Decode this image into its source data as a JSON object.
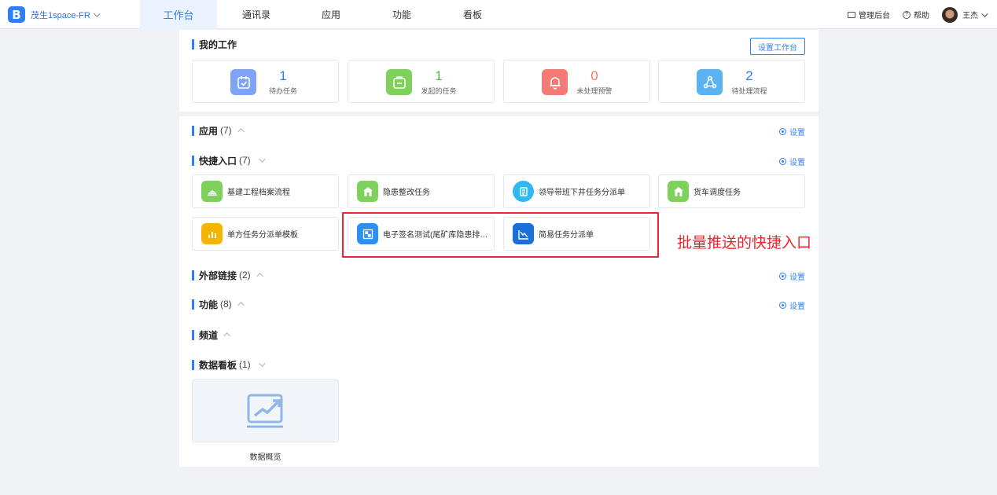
{
  "header": {
    "brand_logo": "B",
    "brand_name": "茂生1space-FR",
    "tabs": [
      "工作台",
      "通讯录",
      "应用",
      "功能",
      "看板"
    ],
    "right": {
      "admin": "管理后台",
      "help": "帮助",
      "user": "王杰"
    }
  },
  "my_work": {
    "title": "我的工作",
    "set_button": "设置工作台",
    "stats": [
      {
        "value": "1",
        "label": "待办任务",
        "color": "#7fa3f5",
        "icon": "calendar-check-icon"
      },
      {
        "value": "1",
        "label": "发起的任务",
        "color": "#7ed25b",
        "icon": "briefcase-icon"
      },
      {
        "value": "0",
        "label": "未处理预警",
        "color": "#f47a76",
        "icon": "bell-icon"
      },
      {
        "value": "2",
        "label": "待处理流程",
        "color": "#5ab2f0",
        "icon": "flow-icon"
      }
    ],
    "value_colors": [
      "#2f7ff3",
      "#5cb74a",
      "#f07a6a",
      "#2f7ff3"
    ]
  },
  "sections": {
    "apps": {
      "title": "应用",
      "count": "(7)",
      "setting": "设置"
    },
    "quick": {
      "title": "快捷入口",
      "count": "(7)",
      "setting": "设置"
    },
    "links": {
      "title": "外部链接",
      "count": "(2)",
      "setting": "设置"
    },
    "functions": {
      "title": "功能",
      "count": "(8)",
      "setting": "设置"
    },
    "channel": {
      "title": "频道"
    },
    "boards": {
      "title": "数据看板",
      "count": "(1)"
    }
  },
  "quick_items": [
    {
      "label": "基建工程档案流程",
      "color": "#7ed25b",
      "icon": "cloud-icon"
    },
    {
      "label": "隐患整改任务",
      "color": "#7ed25b",
      "icon": "house-icon"
    },
    {
      "label": "领导带班下井任务分派单",
      "color": "#30b8f0",
      "icon": "document-icon"
    },
    {
      "label": "货车调度任务",
      "color": "#7ed25b",
      "icon": "house-icon"
    },
    {
      "label": "单方任务分派单模板",
      "color": "#f5b400",
      "icon": "chart-icon"
    },
    {
      "label": "电子签名测试(尾矿库隐患排查...",
      "color": "#2f8ff0",
      "icon": "qr-icon"
    },
    {
      "label": "简易任务分派单",
      "color": "#1a6fd8",
      "icon": "trend-down-icon"
    }
  ],
  "board_items": [
    {
      "label": "数据概览",
      "icon": "line-chart-icon"
    }
  ],
  "annotation": "批量推送的快捷入口"
}
